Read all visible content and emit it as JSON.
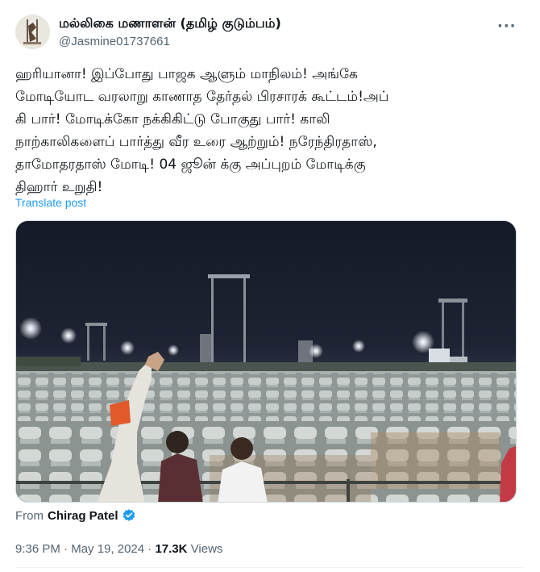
{
  "author": {
    "display_name": "மல்லிகை மணாளன் (தமிழ் குடும்பம்)",
    "handle": "@Jasmine01737661"
  },
  "more_icon": "more-horizontal-icon",
  "post": {
    "lines": [
      "ஹரியானா! இப்போது பாஜக ஆளும் மாநிலம்! அங்கே",
      "மோடியோட வரலாறு காணாத தேர்தல் பிரசாரக் கூட்டம்!அப்",
      "கி பார்! மோடிக்கோ நக்கிகிட்டு போகுது பார்! காலி",
      "நாற்காலிகளைப் பார்த்து வீர உரை ஆற்றும்! நரேந்திரதாஸ்,",
      "தாமோதரதாஸ்  மோடி! 04 ஜூன் க்கு அப்புறம் மோடிக்கு",
      "திஹார் உறுதி!"
    ],
    "translate_label": "Translate post"
  },
  "attribution": {
    "prefix": "From",
    "source_name": "Chirag Patel",
    "verified_icon": "verified-badge-icon",
    "verified_color": "#1d9bf0"
  },
  "meta": {
    "time": "9:36 PM",
    "separator": "·",
    "date": "May 19, 2024",
    "views_count": "17.3K",
    "views_label": "Views"
  },
  "colors": {
    "text": "#0f1419",
    "secondary": "#536471",
    "link": "#1d9bf0"
  }
}
